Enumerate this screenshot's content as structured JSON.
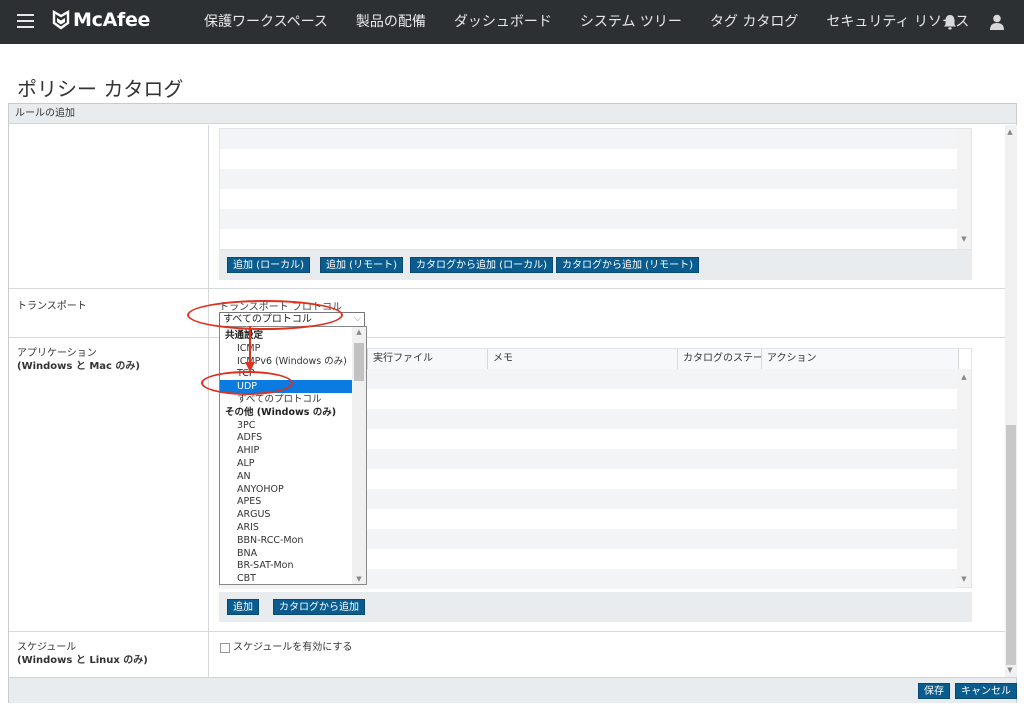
{
  "nav": {
    "logo_text": "McAfee",
    "items": [
      "保護ワークスペース",
      "製品の配備",
      "ダッシュボード",
      "システム ツリー",
      "タグ カタログ",
      "セキュリティ リソース"
    ],
    "bell_icon": "bell-icon",
    "user_icon": "user-icon"
  },
  "page": {
    "title": "ポリシー カタログ"
  },
  "section": {
    "header": "ルールの追加"
  },
  "top_grid": {
    "buttons": [
      "追加 (ローカル)",
      "追加 (リモート)",
      "カタログから追加 (ローカル)",
      "カタログから追加 (リモート)"
    ]
  },
  "transport": {
    "label": "トランスポート",
    "protocol_label": "トランスポート プロトコル",
    "selected": "すべてのプロトコル"
  },
  "dropdown": {
    "options": [
      {
        "text": "共通設定",
        "group": true
      },
      {
        "text": "ICMP"
      },
      {
        "text": "ICMPv6 (Windows のみ)"
      },
      {
        "text": "TCP"
      },
      {
        "text": "UDP",
        "selected": true
      },
      {
        "text": "すべてのプロトコル"
      },
      {
        "text": "その他 (Windows のみ)",
        "group": true
      },
      {
        "text": "3PC"
      },
      {
        "text": "ADFS"
      },
      {
        "text": "AHIP"
      },
      {
        "text": "ALP"
      },
      {
        "text": "AN"
      },
      {
        "text": "ANYOHOP"
      },
      {
        "text": "APES"
      },
      {
        "text": "ARGUS"
      },
      {
        "text": "ARIS"
      },
      {
        "text": "BBN-RCC-Mon"
      },
      {
        "text": "BNA"
      },
      {
        "text": "BR-SAT-Mon"
      },
      {
        "text": "CBT"
      }
    ]
  },
  "application": {
    "label_line1": "アプリケーション",
    "label_line2": "(Windows と Mac のみ)",
    "columns": [
      "実行ファイル",
      "メモ",
      "カタログのステータス",
      "アクション"
    ],
    "buttons": [
      "追加",
      "カタログから追加"
    ]
  },
  "schedule": {
    "label_line1": "スケジュール",
    "label_line2": "(Windows と Linux のみ)",
    "checkbox_label": "スケジュールを有効にする"
  },
  "footer": {
    "save": "保存",
    "cancel": "キャンセル"
  },
  "colors": {
    "nav_bg": "#2c3033",
    "button_bg": "#0b5c8e",
    "selection": "#0a7be0",
    "annotation_ring": "#e0301e"
  }
}
